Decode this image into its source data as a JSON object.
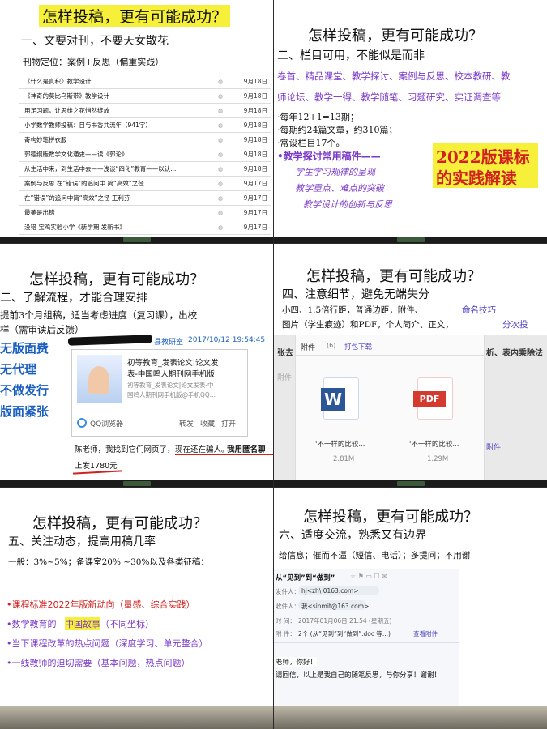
{
  "p1": {
    "title": "怎样投稿，更有可能成功？",
    "h2": "一、文要对刊，不要天女散花",
    "sub": "刊物定位：案例+反思（偏重实践）",
    "rows": [
      {
        "t": "《什么是真积》教学设计",
        "d": "9月18日"
      },
      {
        "t": "《神奇的莫比乌斯带》教学设计",
        "d": "9月18日"
      },
      {
        "t": "用足习题，让思维之花悄然绽放",
        "d": "9月18日"
      },
      {
        "t": "小学数学教师投稿：目与书香共流年（941字）",
        "d": "9月18日"
      },
      {
        "t": "奇构妙笔拼衣服",
        "d": "9月18日"
      },
      {
        "t": "郭德纲版数学文化通史——读《郭论》",
        "d": "9月18日"
      },
      {
        "t": "从生活中来，到生活中去——浅谈“四化”教育——以认...",
        "d": "9月18日"
      },
      {
        "t": "案例与反思 在“错误”的追问中 简“高效”之径",
        "d": "9月17日"
      },
      {
        "t": "在“错误”的追问中简“高效”之径 王利芬",
        "d": "9月17日"
      },
      {
        "t": "最美是出错",
        "d": "9月17日"
      },
      {
        "t": "没错 宝鸡实验小学《新学期 发新书》",
        "d": "9月17日"
      }
    ],
    "icon": "◍"
  },
  "p2": {
    "title": "怎样投稿，更有可能成功？",
    "h2": "二、栏目可用，不能似是而非",
    "cols1": "卷首、精品课堂、教学探讨、案例与反思、校本教研、教",
    "cols2": "师论坛、教学一得、教学随笔、习题研究、实证调查等",
    "b1": "·每年12+1=13期；",
    "b2": "·每期约24篇文章，约310篇；",
    "b3": "·常设栏目17个。",
    "b4": "•教学探讨常用稿件——",
    "i1": "学生学习规律的呈现",
    "i2": "教学重点、难点的突破",
    "i3": "教学设计的创新与反思",
    "badge1": "2022版课标",
    "badge2": "的实践解读"
  },
  "p3": {
    "title": "怎样投稿，更有可能成功？",
    "h2": "二、了解流程，才能合理安排",
    "l1": "提前3个月组稿，适当考虑进度（复习课），出校",
    "l2": "样（需审读后反馈）",
    "s1": "无版面费",
    "s2": "无代理",
    "s3": "不做发行",
    "s4": "版面紧张",
    "sender": "县教研室",
    "time": "2017/10/12 19:54:45",
    "ad1": "初等教育_发表论文|论文发",
    "ad2": "表-中国鸣人期刊网手机版",
    "ad3": "初等教育_发表论文|论文发表-中",
    "ad4": "国鸣人期刊网手机版@手机QQ...",
    "browser": "QQ浏览器",
    "forward": "转发",
    "collect": "收藏",
    "open": "打开",
    "msg1": "陈老师，我找到它们网页了，",
    "msg2": "现在还在骗人。",
    "msg3": "我用匿名聊",
    "msg4": "上发1780元"
  },
  "p4": {
    "title": "怎样投稿，更有可能成功？",
    "h2": "四、注意细节，避免无端失分",
    "l1a": "小四、1.5倍行距，普通边距，附件、",
    "l1b": "命名技巧",
    "l2a": "图片（学生痕迹）和PDF，个人简介、正文，",
    "l2b": "分次投",
    "att": "附件",
    "attc": "(6)",
    "pack": "打包下载",
    "side1": "张去",
    "side2": "附件",
    "right1": "析、表内乘除法",
    "right2": "附件",
    "f1name": "'不一样的比较...",
    "f1size": "2.81M",
    "f2name": "'不一样的比较...",
    "f2size": "1.29M",
    "w": "W",
    "pdf": "PDF"
  },
  "p5": {
    "title": "怎样投稿，更有可能成功？",
    "h2": "五、关注动态，提高用稿几率",
    "l1": "一般：3%~5%；备课室20% ~30%以及各类征稿：",
    "b1": "•课程标准2022年版新动向（量感、综合实践）",
    "b2a": "•数学教育的",
    "b2b": "中国故事",
    "b2c": "（不同坐标）",
    "b3": "•当下课程改革的热点问题（深度学习、单元整合）",
    "b4": "•一线教师的迫切需要（基本问题，热点问题）"
  },
  "p6": {
    "title": "怎样投稿，更有可能成功？",
    "h2": "六、适度交流，熟悉又有边界",
    "l1": "给信息；催而不逼（短信、电话）；多提问；不用谢",
    "subj": "从“见到”到“做到”",
    "from_label": "发件人：",
    "from": "hj<zh\\      0163.com>",
    "to_label": "收件人：",
    "to": "我<sinmit@163.com>",
    "time_label": "时 间：",
    "time": "2017年01月06日 21:54 (星期五)",
    "att_label": "附 件：",
    "att": "2个 (从“见到”到“做到”.doc 等...)",
    "view": "查看附件",
    "body1": "老师，你好！",
    "body2": "请回信，以上是我自己的随笔反思，与你分享！谢谢！"
  }
}
